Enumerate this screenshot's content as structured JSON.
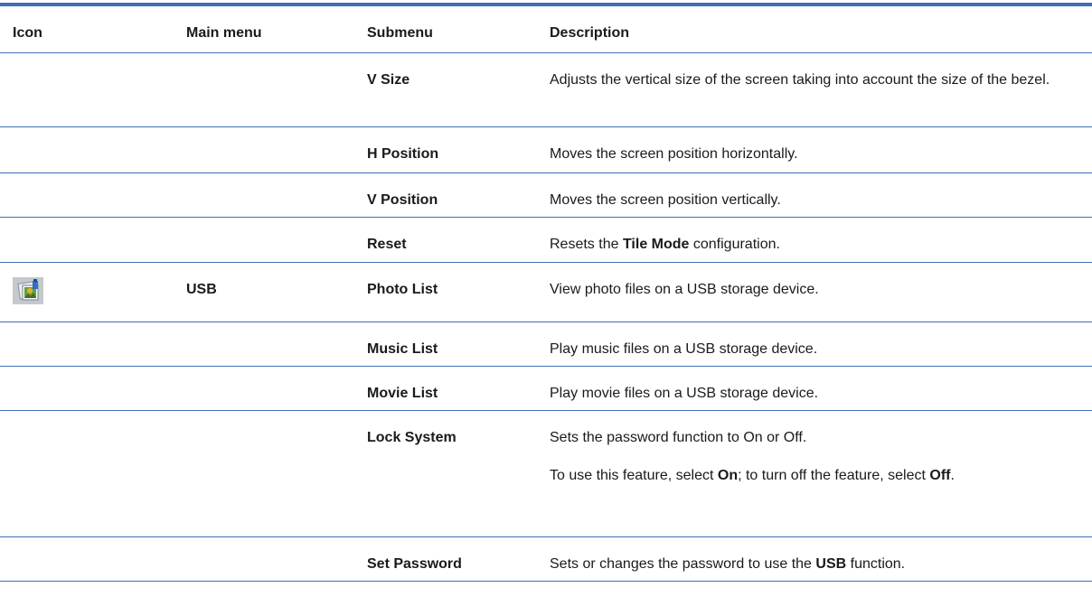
{
  "header": {
    "icon": "Icon",
    "main_menu": "Main menu",
    "submenu": "Submenu",
    "description": "Description"
  },
  "rows": [
    {
      "icon": "",
      "main": "",
      "sub": "V Size",
      "desc": "Adjusts the vertical size of the screen taking into account the size of the bezel."
    },
    {
      "icon": "",
      "main": "",
      "sub": "H Position",
      "desc": "Moves the screen position horizontally."
    },
    {
      "icon": "",
      "main": "",
      "sub": "V Position",
      "desc": "Moves the screen position vertically."
    },
    {
      "icon": "",
      "main": "",
      "sub": "Reset",
      "desc_pre": "Resets the ",
      "desc_bold": "Tile Mode",
      "desc_post": " configuration."
    },
    {
      "icon": "photo-usb-icon",
      "main": "USB",
      "sub": "Photo List",
      "desc": "View photo files on a USB storage device."
    },
    {
      "icon": "",
      "main": "",
      "sub": "Music List",
      "desc": "Play music files on a USB storage device."
    },
    {
      "icon": "",
      "main": "",
      "sub": "Movie List",
      "desc": "Play movie files on a USB storage device."
    },
    {
      "icon": "",
      "main": "",
      "sub": "Lock System",
      "desc": "Sets the password function to On or Off.",
      "desc2_pre": "To use this feature, select ",
      "desc2_bold1": "On",
      "desc2_mid": "; to turn off the feature, select ",
      "desc2_bold2": "Off",
      "desc2_post": "."
    },
    {
      "icon": "",
      "main": "",
      "sub": "Set Password",
      "desc_pre": "Sets or changes the password to use the ",
      "desc_bold": "USB",
      "desc_post": " function."
    }
  ],
  "colors": {
    "rule": "#3f6fb5"
  }
}
